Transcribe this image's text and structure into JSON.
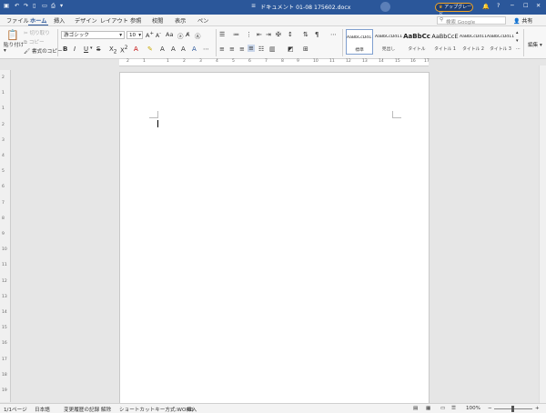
{
  "titlebar": {
    "doc_title": "ドキュメント 01-08 175602.docx",
    "upgrade_label": "アップグレード"
  },
  "tabs": [
    "ファイル",
    "ホーム",
    "挿入",
    "デザイン",
    "レイアウト",
    "参照",
    "校閲",
    "表示",
    "ペン"
  ],
  "search": {
    "placeholder": "検索 Google"
  },
  "share_label": "共有",
  "ribbon": {
    "paste_label": "貼り付け",
    "cut_label": "切り取り",
    "copy_label": "コピー",
    "format_painter_label": "書式のコピー",
    "font_name": "游ゴシック",
    "font_size": "10",
    "styles": [
      {
        "preview": "AaBbCcDd11",
        "label": "標準"
      },
      {
        "preview": "AaBbCcDd11",
        "label": "見出し"
      },
      {
        "preview": "AaBbCc",
        "label": "タイトル"
      },
      {
        "preview": "AaBbCcE",
        "label": "タイトル 1"
      },
      {
        "preview": "AaBbCcDd11",
        "label": "タイトル 2"
      },
      {
        "preview": "AaBbCcDd11",
        "label": "タイトル 3"
      }
    ],
    "edit_label": "編集"
  },
  "ruler": {
    "h_ticks": [
      "2",
      "1",
      "1",
      "2",
      "3",
      "4",
      "5",
      "6",
      "7",
      "8",
      "9",
      "10",
      "11",
      "12",
      "13",
      "14",
      "15",
      "16",
      "17",
      "18"
    ],
    "v_ticks": [
      "2",
      "1",
      "1",
      "2",
      "3",
      "4",
      "5",
      "6",
      "7",
      "8",
      "9",
      "10",
      "11",
      "12",
      "13",
      "14",
      "15",
      "16",
      "17",
      "18",
      "19"
    ]
  },
  "status": {
    "page": "1/1ページ",
    "language": "日本語",
    "track_changes": "変更履歴の記録 解除",
    "shortcut": "ショートカットキー方式:WORD",
    "insert_mode": "挿入",
    "zoom": "100%"
  },
  "colors": {
    "accent": "#2b579a",
    "upgrade": "#f5a623"
  }
}
